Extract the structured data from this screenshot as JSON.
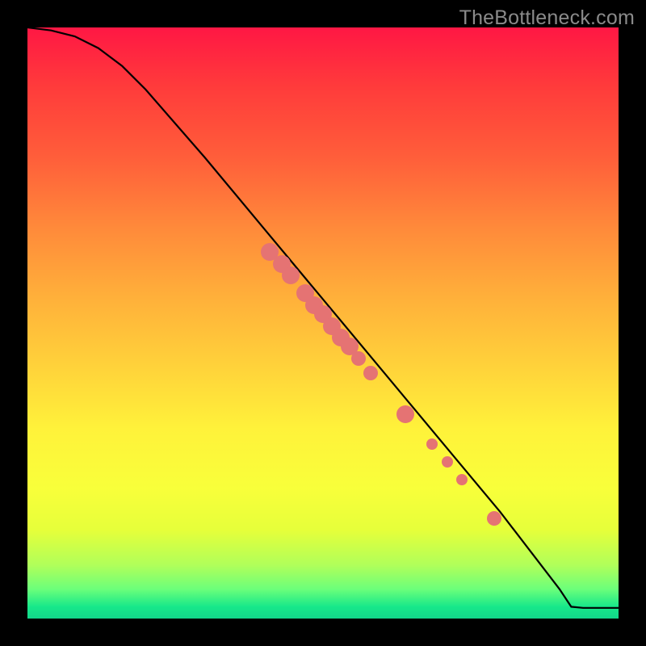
{
  "watermark": "TheBottleneck.com",
  "chart_data": {
    "type": "line",
    "title": "",
    "xlabel": "",
    "ylabel": "",
    "xlim": [
      0,
      100
    ],
    "ylim": [
      0,
      100
    ],
    "grid": false,
    "legend": false,
    "background": "gradient red→yellow→green (top→bottom)",
    "series": [
      {
        "name": "curve",
        "kind": "line",
        "color": "#000000",
        "points": [
          {
            "x": 0,
            "y": 100
          },
          {
            "x": 4,
            "y": 99.5
          },
          {
            "x": 8,
            "y": 98.5
          },
          {
            "x": 12,
            "y": 96.5
          },
          {
            "x": 16,
            "y": 93.5
          },
          {
            "x": 20,
            "y": 89.5
          },
          {
            "x": 30,
            "y": 78
          },
          {
            "x": 40,
            "y": 66
          },
          {
            "x": 50,
            "y": 54
          },
          {
            "x": 60,
            "y": 42
          },
          {
            "x": 70,
            "y": 30
          },
          {
            "x": 80,
            "y": 18
          },
          {
            "x": 90,
            "y": 5
          },
          {
            "x": 92,
            "y": 2
          },
          {
            "x": 94,
            "y": 1.8
          },
          {
            "x": 100,
            "y": 1.8
          }
        ]
      },
      {
        "name": "dots",
        "kind": "scatter",
        "color": "#e57373",
        "points": [
          {
            "x": 41,
            "y": 62,
            "size": "l"
          },
          {
            "x": 43,
            "y": 60,
            "size": "l"
          },
          {
            "x": 44.5,
            "y": 58,
            "size": "l"
          },
          {
            "x": 47,
            "y": 55,
            "size": "l"
          },
          {
            "x": 48.5,
            "y": 53,
            "size": "l"
          },
          {
            "x": 50,
            "y": 51.5,
            "size": "l"
          },
          {
            "x": 51.5,
            "y": 49.5,
            "size": "l"
          },
          {
            "x": 53,
            "y": 47.5,
            "size": "l"
          },
          {
            "x": 54.5,
            "y": 46,
            "size": "l"
          },
          {
            "x": 56,
            "y": 44,
            "size": "m"
          },
          {
            "x": 58,
            "y": 41.5,
            "size": "m"
          },
          {
            "x": 64,
            "y": 34.5,
            "size": "l"
          },
          {
            "x": 68.5,
            "y": 29.5,
            "size": "s"
          },
          {
            "x": 71,
            "y": 26.5,
            "size": "s"
          },
          {
            "x": 73.5,
            "y": 23.5,
            "size": "s"
          },
          {
            "x": 79,
            "y": 17,
            "size": "m"
          }
        ]
      }
    ]
  }
}
